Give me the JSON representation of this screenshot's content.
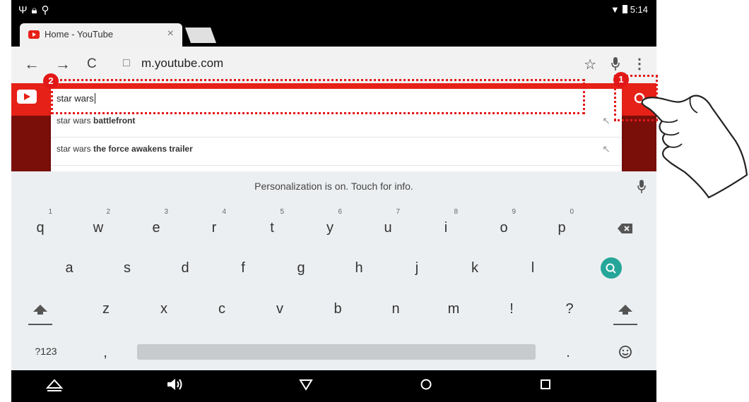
{
  "status_bar": {
    "left_icons": [
      "usb-icon",
      "lock-icon",
      "bulb-icon"
    ],
    "time": "5:14"
  },
  "browser": {
    "tab_title": "Home - YouTube",
    "tab_close": "×",
    "url": "m.youtube.com",
    "nav": {
      "back": "←",
      "forward": "→",
      "reload": "C"
    }
  },
  "youtube": {
    "search_value": "star wars",
    "suggestions": [
      {
        "prefix": "star wars",
        "bold": "battlefront",
        "arrow": "↖"
      },
      {
        "prefix": "star wars",
        "bold": "the force awakens trailer",
        "arrow": "↖"
      }
    ]
  },
  "keyboard": {
    "info": "Personalization is on. Touch for info.",
    "row1": [
      {
        "k": "q",
        "h": "1"
      },
      {
        "k": "w",
        "h": "2"
      },
      {
        "k": "e",
        "h": "3"
      },
      {
        "k": "r",
        "h": "4"
      },
      {
        "k": "t",
        "h": "5"
      },
      {
        "k": "y",
        "h": "6"
      },
      {
        "k": "u",
        "h": "7"
      },
      {
        "k": "i",
        "h": "8"
      },
      {
        "k": "o",
        "h": "9"
      },
      {
        "k": "p",
        "h": "0"
      }
    ],
    "row2": [
      "a",
      "s",
      "d",
      "f",
      "g",
      "h",
      "j",
      "k",
      "l"
    ],
    "row3": [
      "z",
      "x",
      "c",
      "v",
      "b",
      "n",
      "m",
      "!",
      "?"
    ],
    "symbols_key": "?123",
    "comma_key": ",",
    "period_key": "."
  },
  "overlay": {
    "badge_1": "1",
    "badge_2": "2",
    "accent": "#e21818"
  },
  "colors": {
    "youtube_red": "#e62117",
    "search_key": "#26a69a"
  }
}
